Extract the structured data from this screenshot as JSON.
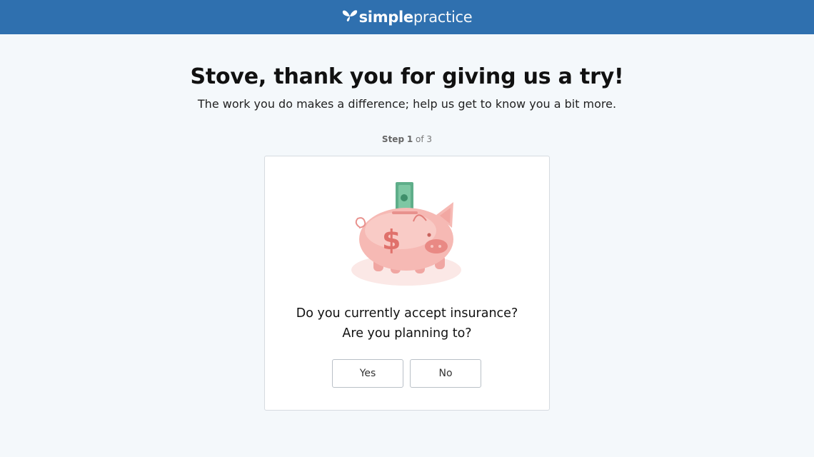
{
  "header": {
    "logo_bold": "simple",
    "logo_light": "practice",
    "bg_color": "#2f70af"
  },
  "main": {
    "headline": "Stove, thank you for giving us a try!",
    "subhead": "The work you do makes a difference; help us get to know you a bit more.",
    "step": {
      "label": "Step",
      "current": "1",
      "of_text": "of 3"
    }
  },
  "card": {
    "illustration": "piggy-bank-icon",
    "question_line1": "Do you currently accept insurance?",
    "question_line2": "Are you planning to?",
    "yes_label": "Yes",
    "no_label": "No"
  }
}
